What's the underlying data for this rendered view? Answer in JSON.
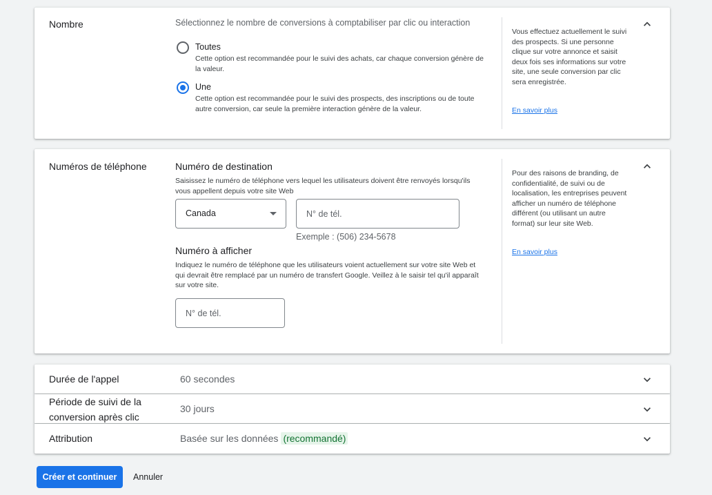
{
  "nombre": {
    "title": "Nombre",
    "prompt": "Sélectionnez le nombre de conversions à comptabiliser par clic ou interaction",
    "options": [
      {
        "label": "Toutes",
        "description": "Cette option est recommandée pour le suivi des achats, car chaque conversion génère de la valeur.",
        "selected": false
      },
      {
        "label": "Une",
        "description": "Cette option est recommandée pour le suivi des prospects, des inscriptions ou de toute autre conversion, car seule la première interaction génère de la valeur.",
        "selected": true
      }
    ],
    "help_text": "Vous effectuez actuellement le suivi des prospects. Si une personne clique sur votre annonce et saisit deux fois ses informations sur votre site, une seule conversion par clic sera enregistrée.",
    "help_link": "En savoir plus"
  },
  "phone": {
    "title": "Numéros de téléphone",
    "dest_title": "Numéro de destination",
    "dest_desc": "Saisissez le numéro de téléphone vers lequel les utilisateurs doivent être renvoyés lorsqu'ils vous appellent depuis votre site Web",
    "country_value": "Canada",
    "dest_placeholder": "N° de tél.",
    "example": "Exemple : (506) 234-5678",
    "display_title": "Numéro à afficher",
    "display_desc": "Indiquez le numéro de téléphone que les utilisateurs voient actuellement sur votre site Web et qui devrait être remplacé par un numéro de transfert Google. Veillez à le saisir tel qu'il apparaît sur votre site.",
    "display_placeholder": "N° de tél.",
    "help_text": "Pour des raisons de branding, de confidentialité, de suivi ou de localisation, les entreprises peuvent afficher un numéro de téléphone différent (ou utilisant un autre format) sur leur site Web.",
    "help_link": "En savoir plus"
  },
  "rows": {
    "duration": {
      "title": "Durée de l'appel",
      "value": "60 secondes"
    },
    "tracking": {
      "title": "Période de suivi de la conversion après clic",
      "value": "30 jours"
    },
    "attribution": {
      "title": "Attribution",
      "value": "Basée sur les données",
      "badge": "(recommandé)"
    }
  },
  "actions": {
    "primary": "Créer et continuer",
    "cancel": "Annuler"
  },
  "colors": {
    "accent": "#1a73e8",
    "badge_bg": "#e6f4ea",
    "badge_text": "#137333"
  }
}
